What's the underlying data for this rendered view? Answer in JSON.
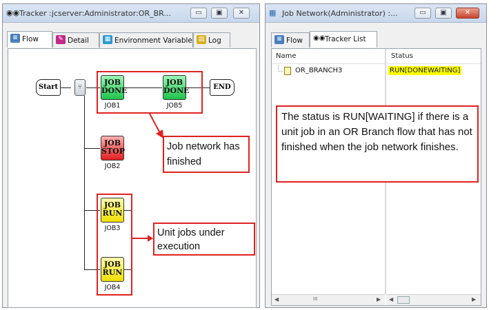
{
  "left_window": {
    "title": "Tracker :jcserver:Administrator:OR_BR...",
    "title_icon": "tracker-binoculars-icon",
    "controls": {
      "minimize": "▭",
      "maximize": "▣",
      "close": "✕"
    },
    "tabs": [
      {
        "label": "Flow",
        "icon": "flow-icon",
        "active": true
      },
      {
        "label": "Detail",
        "icon": "detail-icon",
        "active": false
      },
      {
        "label": "Environment Variable",
        "icon": "env-icon",
        "active": false
      },
      {
        "label": "Log",
        "icon": "log-icon",
        "active": false
      }
    ],
    "flow": {
      "start_label": "Start",
      "end_label": "END",
      "jobs": [
        {
          "name": "JOB1",
          "icon_text": [
            "JOB",
            "DONE"
          ],
          "status": "done"
        },
        {
          "name": "JOB5",
          "icon_text": [
            "JOB",
            "DONE"
          ],
          "status": "done"
        },
        {
          "name": "JOB2",
          "icon_text": [
            "JOB",
            "STOP"
          ],
          "status": "stop"
        },
        {
          "name": "JOB3",
          "icon_text": [
            "JOB",
            "RUN"
          ],
          "status": "run"
        },
        {
          "name": "JOB4",
          "icon_text": [
            "JOB",
            "RUN"
          ],
          "status": "run"
        }
      ],
      "callout_finished": "Job network has finished",
      "callout_running": "Unit jobs under execution"
    }
  },
  "right_window": {
    "title": "Job Network(Administrator) :...",
    "controls": {
      "minimize": "▭",
      "maximize": "▣",
      "close": "✕"
    },
    "tabs": [
      {
        "label": "Flow",
        "icon": "flow-icon",
        "active": false
      },
      {
        "label": "Tracker List",
        "icon": "tracker-binoculars-icon",
        "active": true
      }
    ],
    "columns": [
      "Name",
      "Status"
    ],
    "rows": [
      {
        "name": "OR_BRANCH3",
        "status": "RUN[DONEWAITING]"
      }
    ],
    "callout": "The status is RUN[WAITING] if there is a unit job in an OR Branch flow that has not finished when the job network finishes.",
    "scroll_grip": "III"
  },
  "colors": {
    "callout_border": "#e02020",
    "status_highlight": "#ffff00",
    "done": "#1fc44c",
    "stop": "#e01f1f",
    "run": "#f0e000"
  }
}
